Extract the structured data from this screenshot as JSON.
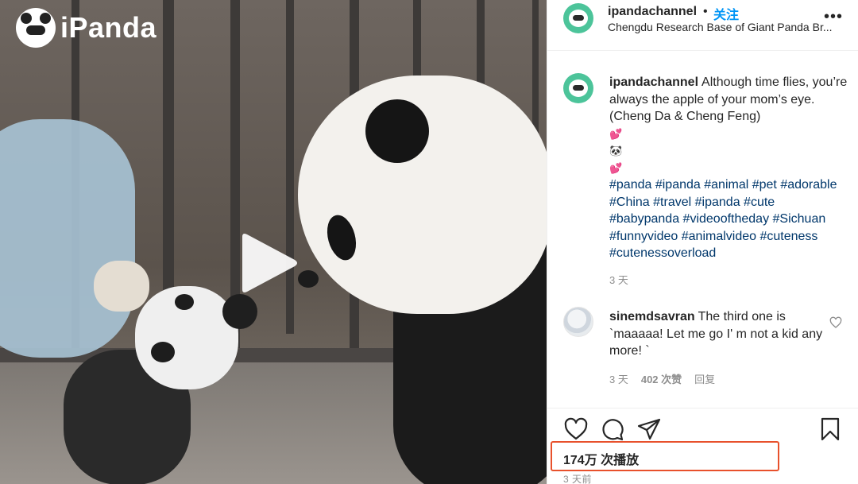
{
  "media": {
    "watermark": "iPanda",
    "play_icon": "play-icon"
  },
  "post": {
    "header": {
      "username": "ipandachannel",
      "separator": "•",
      "follow_label": "关注",
      "location": "Chengdu Research Base of Giant Panda Br...",
      "more_icon": "more-horizontal-icon"
    },
    "caption": {
      "username": "ipandachannel",
      "text": "Although time flies, you’re always the apple of your mom’s eye. (Cheng Da & Cheng Feng)",
      "emojis": [
        "💕",
        "🐼",
        "💕"
      ],
      "hashtags": [
        "#panda",
        "#ipanda",
        "#animal",
        "#pet",
        "#adorable",
        "#China",
        "#travel",
        "#ipanda",
        "#cute",
        "#babypanda",
        "#videooftheday",
        "#Sichuan",
        "#funnyvideo",
        "#animalvideo",
        "#cuteness",
        "#cutenessoverload"
      ],
      "age": "3 天"
    },
    "comments": [
      {
        "username": "sinemdsavran",
        "text": "The third one is `maaaaa! Let me go I' m not a kid any more! `",
        "age": "3 天",
        "likes": "402 次赞",
        "reply_label": "回复"
      }
    ],
    "actions": {
      "like_icon": "heart-icon",
      "comment_icon": "comment-icon",
      "share_icon": "send-icon",
      "save_icon": "bookmark-icon"
    },
    "views": "174万 次播放",
    "timestamp": "3 天前"
  },
  "colors": {
    "accent": "#0095f6",
    "highlight_box": "#e8512c",
    "avatar_green": "#4cc49a",
    "hashtag": "#00376b",
    "secondary_text": "#8e8e8e"
  }
}
